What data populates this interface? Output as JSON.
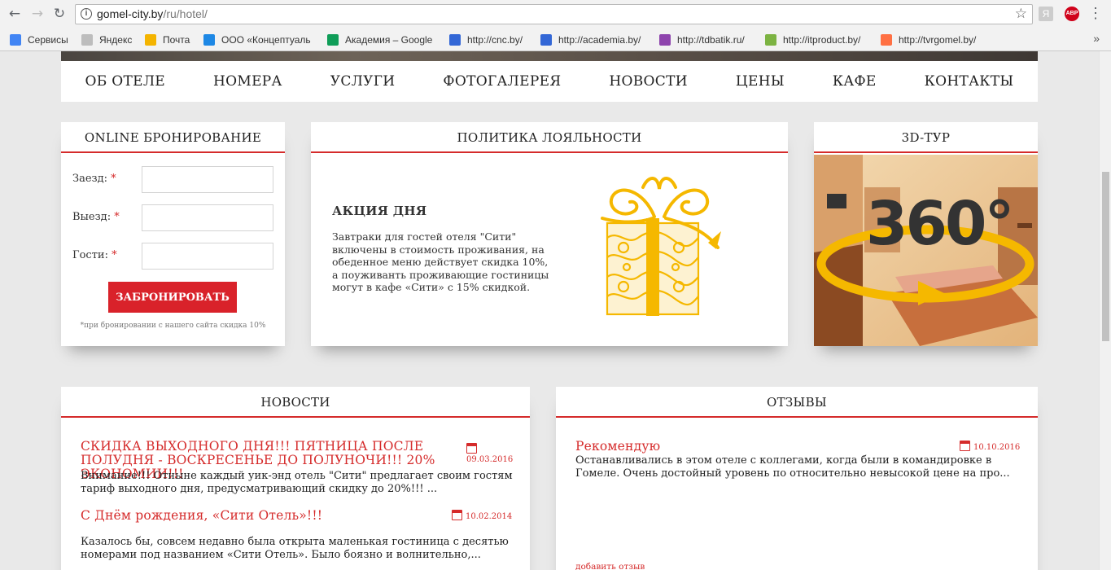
{
  "browser": {
    "url_host": "gomel-city.by",
    "url_path": "/ru/hotel/",
    "bookmarks": [
      {
        "label": "Сервисы",
        "color": "#4285f4"
      },
      {
        "label": "Яндекс",
        "color": "#bdbdbd"
      },
      {
        "label": "Почта",
        "color": "#f4b400"
      },
      {
        "label": "ООО «Концептуаль",
        "color": "#1e88e5"
      },
      {
        "label": "Академия – Google",
        "color": "#0f9d58"
      },
      {
        "label": "http://cnc.by/",
        "color": "#3367d6"
      },
      {
        "label": "http://academia.by/",
        "color": "#3367d6"
      },
      {
        "label": "http://tdbatik.ru/",
        "color": "#8e44ad"
      },
      {
        "label": "http://itproduct.by/",
        "color": "#7cb342"
      },
      {
        "label": "http://tvrgomel.by/",
        "color": "#ff7043"
      }
    ]
  },
  "nav": {
    "items": [
      "ОБ ОТЕЛЕ",
      "НОМЕРА",
      "УСЛУГИ",
      "ФОТОГАЛЕРЕЯ",
      "НОВОСТИ",
      "ЦЕНЫ",
      "КАФЕ",
      "КОНТАКТЫ"
    ]
  },
  "booking": {
    "title": "ONLINE БРОНИРОВАНИЕ",
    "checkin_label": "Заезд:",
    "checkout_label": "Выезд:",
    "guests_label": "Гости:",
    "required_mark": "*",
    "button": "ЗАБРОНИРОВАТЬ",
    "note": "*при бронировании с нашего сайта скидка 10%"
  },
  "loyalty": {
    "title": "ПОЛИТИКА ЛОЯЛЬНОСТИ",
    "promo_heading": "АКЦИЯ ДНЯ",
    "promo_text": "Завтраки для гостей отеля \"Сити\" включены в стоимость проживания, на обеденное меню действует скидка 10%, а поуживанть проживающие гостиницы могут в кафе «Сити» с 15% скидкой."
  },
  "tour": {
    "title": "3D-ТУР",
    "badge": "360°"
  },
  "news": {
    "title": "НОВОСТИ",
    "items": [
      {
        "title": "СКИДКА ВЫХОДНОГО ДНЯ!!! ПЯТНИЦА ПОСЛЕ ПОЛУДНЯ - ВОСКРЕСЕНЬЕ ДО ПОЛУНОЧИ!!! 20% ЭКОНОМИИ!!!",
        "date": "09.03.2016",
        "text": "Внимание!!! Отныне каждый уик-энд отель \"Сити\" предлагает своим гостям тариф выходного дня, предусматривающий скидку до 20%!!! ..."
      },
      {
        "title": "С Днём рождения, «Сити Отель»!!!",
        "date": "10.02.2014",
        "text": "Казалось бы, совсем недавно была открыта маленькая гостиница с десятью номерами под названием «Сити Отель». Было боязно и волнительно,..."
      }
    ]
  },
  "reviews": {
    "title": "ОТЗЫВЫ",
    "items": [
      {
        "title": "Рекомендую",
        "date": "10.10.2016",
        "text": "Останавливались в этом отеле с коллегами, когда были в командировке в Гомеле. Очень достойный уровень по относительно невысокой цене на про..."
      }
    ],
    "add_link": "добавить отзыв"
  },
  "colors": {
    "accent": "#d52b2b",
    "button": "#d9222a",
    "gift": "#f5b800"
  }
}
